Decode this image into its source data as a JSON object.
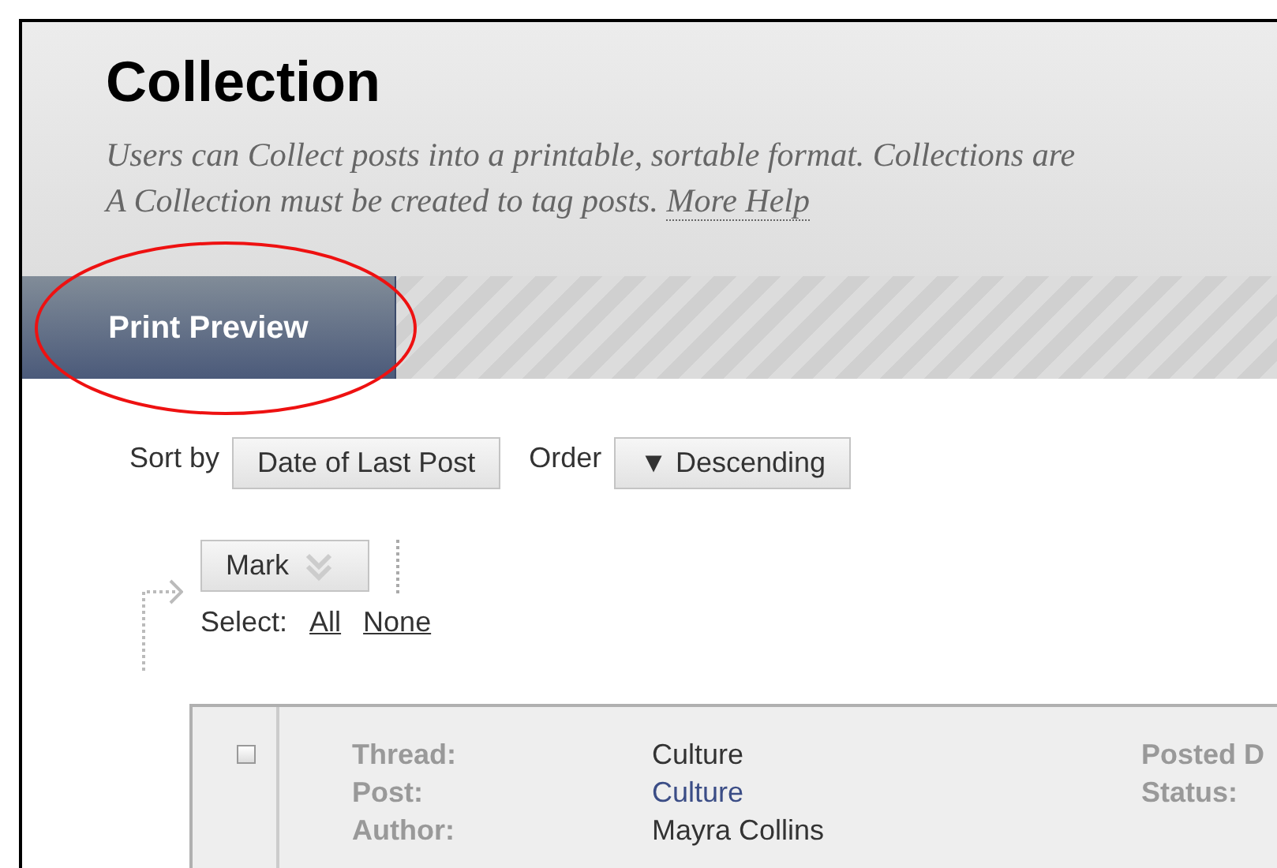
{
  "header": {
    "title": "Collection",
    "description_lines": [
      "Users can Collect posts into a printable, sortable format. Collections are",
      "A Collection must be created to tag posts."
    ],
    "help_link": "More Help"
  },
  "tabs": [
    {
      "label": "Print Preview",
      "selected": true
    }
  ],
  "sort": {
    "label": "Sort by",
    "value": "Date of Last Post"
  },
  "order": {
    "label": "Order",
    "arrow": "▼",
    "value": "Descending"
  },
  "mark": {
    "label": "Mark"
  },
  "select": {
    "label": "Select:",
    "links": [
      "All",
      "None"
    ]
  },
  "posts": [
    {
      "checked": false,
      "fields": [
        {
          "label": "Thread:",
          "value": "Culture",
          "kind": "text"
        },
        {
          "label": "Post:",
          "value": "Culture",
          "kind": "link"
        },
        {
          "label": "Author:",
          "value": "Mayra Collins",
          "kind": "text"
        }
      ],
      "side_fields": [
        {
          "label": "Posted D"
        },
        {
          "label": "Status:"
        }
      ]
    }
  ],
  "annotation": {
    "kind": "ellipse"
  }
}
